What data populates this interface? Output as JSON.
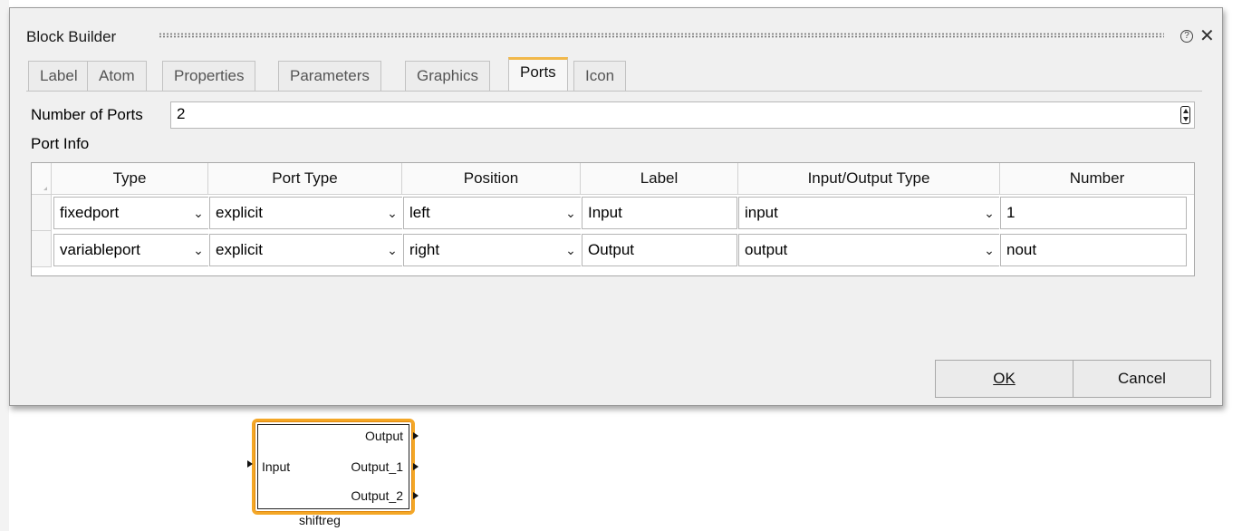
{
  "dialog": {
    "title": "Block Builder",
    "tabs": [
      {
        "label": "Label"
      },
      {
        "label": "Atom"
      },
      {
        "label": "Properties"
      },
      {
        "label": "Parameters"
      },
      {
        "label": "Graphics"
      },
      {
        "label": "Ports",
        "active": true
      },
      {
        "label": "Icon"
      }
    ],
    "number_of_ports_label": "Number of Ports",
    "number_of_ports_value": "2",
    "port_info_label": "Port Info",
    "table": {
      "columns": [
        "Type",
        "Port Type",
        "Position",
        "Label",
        "Input/Output Type",
        "Number"
      ],
      "rows": [
        {
          "type": "fixedport",
          "port_type": "explicit",
          "position": "left",
          "label": "Input",
          "io_type": "input",
          "number": "1"
        },
        {
          "type": "variableport",
          "port_type": "explicit",
          "position": "right",
          "label": "Output",
          "io_type": "output",
          "number": "nout"
        }
      ]
    },
    "ok_label": "OK",
    "cancel_label": "Cancel"
  },
  "block": {
    "name": "shiftreg",
    "input_label": "Input",
    "outputs": [
      "Output",
      "Output_1",
      "Output_2"
    ],
    "accent_color": "#f4a726"
  }
}
